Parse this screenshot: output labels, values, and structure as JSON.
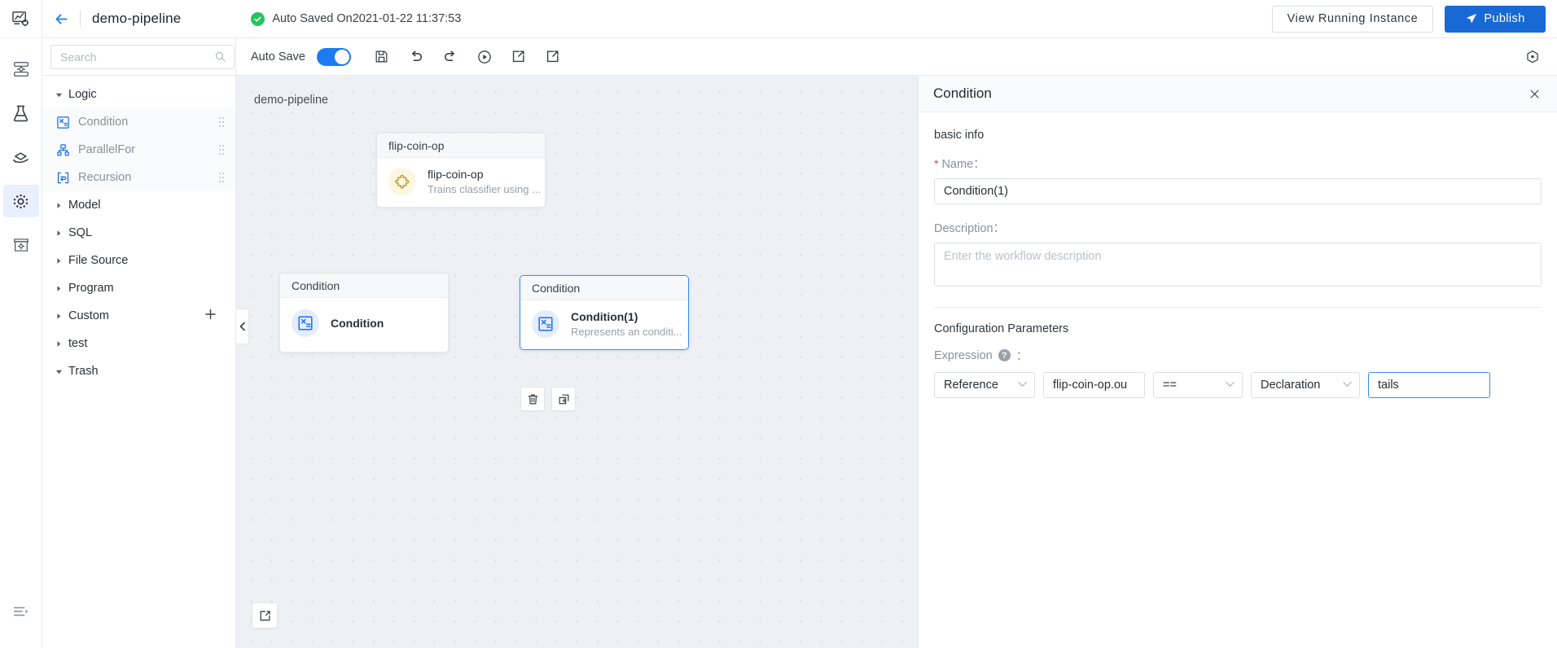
{
  "rail": {
    "logo_icon": "monitor-chart-gear-icon",
    "items": [
      {
        "name": "server-stack-icon",
        "active": false
      },
      {
        "name": "flask-icon",
        "active": false
      },
      {
        "name": "serving-hand-icon",
        "active": false
      },
      {
        "name": "settings-ring-icon",
        "active": true
      },
      {
        "name": "box-gear-icon",
        "active": false
      }
    ],
    "bottom_item": {
      "name": "collapse-list-icon"
    }
  },
  "header": {
    "back_icon": "back-arrow-icon",
    "title": "demo-pipeline",
    "save_status": "Auto Saved On2021-01-22 11:37:53",
    "view_running_instance": "View  Running  Instance",
    "publish": "Publish"
  },
  "toolbar": {
    "auto_save_label": "Auto Save",
    "auto_save_on": true,
    "icons": [
      "save-icon",
      "undo-icon",
      "redo-icon",
      "run-icon",
      "export-icon",
      "import-icon"
    ],
    "right_icon": "hexagon-target-icon"
  },
  "search": {
    "placeholder": "Search",
    "value": "",
    "icon": "search-icon"
  },
  "tree": {
    "groups": [
      {
        "label": "Logic",
        "expanded": true,
        "caret": "caret-down-icon"
      },
      {
        "label": "Model",
        "expanded": false,
        "caret": "caret-right-icon"
      },
      {
        "label": "SQL",
        "expanded": false,
        "caret": "caret-right-icon"
      },
      {
        "label": "File Source",
        "expanded": false,
        "caret": "caret-right-icon"
      },
      {
        "label": "Program",
        "expanded": false,
        "caret": "caret-right-icon"
      },
      {
        "label": "Custom",
        "expanded": false,
        "caret": "caret-right-icon",
        "has_add": true,
        "add_label": "+"
      },
      {
        "label": "test",
        "expanded": false,
        "caret": "caret-right-icon"
      },
      {
        "label": "Trash",
        "expanded": true,
        "caret": "caret-down-icon"
      }
    ],
    "logic_items": [
      {
        "label": "Condition",
        "icon": "condition-icon"
      },
      {
        "label": "ParallelFor",
        "icon": "parallel-for-icon"
      },
      {
        "label": "Recursion",
        "icon": "recursion-icon"
      }
    ]
  },
  "canvas": {
    "label": "demo-pipeline",
    "collapse_icon": "chevron-left-icon",
    "fit_icon": "fit-view-icon",
    "nodes": [
      {
        "header": "flip-coin-op",
        "title": "flip-coin-op",
        "subtitle": "Trains classifier using ...",
        "icon": "puzzle-piece-icon",
        "selected": false
      },
      {
        "header": "Condition",
        "title": "Condition",
        "subtitle": "",
        "icon": "condition-icon",
        "selected": false
      },
      {
        "header": "Condition",
        "title": "Condition(1)",
        "subtitle": "Represents an conditi...",
        "icon": "condition-icon",
        "selected": true
      }
    ],
    "node_actions": [
      {
        "name": "delete-node-button",
        "icon": "trash-icon"
      },
      {
        "name": "copy-node-button",
        "icon": "copy-icon"
      }
    ]
  },
  "props": {
    "title": "Condition",
    "close_icon": "close-icon",
    "basic_info_label": "basic info",
    "name_label": "Name：",
    "name_required": "*",
    "name_value": "Condition(1)",
    "description_label": "Description：",
    "description_value": "",
    "description_placeholder": "Enter the workflow description",
    "config_label": "Configuration Parameters",
    "expression_label": "Expression",
    "expression_colon": "：",
    "help_glyph": "?",
    "expression": {
      "left_type": "Reference",
      "left_value": "flip-coin-op.ou",
      "operator": "==",
      "right_type": "Declaration",
      "right_value": "tails"
    }
  },
  "colors": {
    "accent": "#1869d6",
    "toggle_on": "#1a7cf0",
    "success": "#22c55e",
    "selected_border": "#3d8bf2",
    "required": "#e0404a"
  }
}
